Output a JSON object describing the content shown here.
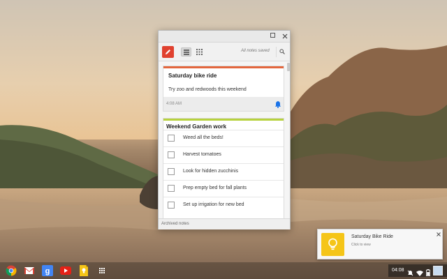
{
  "window": {
    "saved_status": "All notes saved"
  },
  "notes": [
    {
      "title": "Saturday bike ride",
      "text": "Try zoo and redwoods this weekend",
      "time": "4:08 AM",
      "color": "#e3663d"
    },
    {
      "title": "Weekend Garden work",
      "color": "#b7d23d",
      "items": [
        {
          "label": "Weed all the beds!",
          "checked": false
        },
        {
          "label": "Harvest tomatoes",
          "checked": false
        },
        {
          "label": "Look for hidden zucchinis",
          "checked": false
        },
        {
          "label": "Prep empty bed for fall plants",
          "checked": false
        },
        {
          "label": "Set up irrigation for new bed",
          "checked": false
        }
      ]
    }
  ],
  "footer": {
    "archived_label": "Archived notes"
  },
  "notification": {
    "title": "Saturday Bike Ride",
    "subtitle": "Click to view"
  },
  "shelf": {
    "apps": [
      "chrome-icon",
      "gmail-icon",
      "google-search-icon",
      "youtube-icon",
      "keep-icon",
      "app-launcher-icon"
    ],
    "clock": "04:08"
  },
  "colors": {
    "accent": "#e0412f",
    "keep_yellow": "#f5c518",
    "bell_blue": "#1a73e8"
  }
}
